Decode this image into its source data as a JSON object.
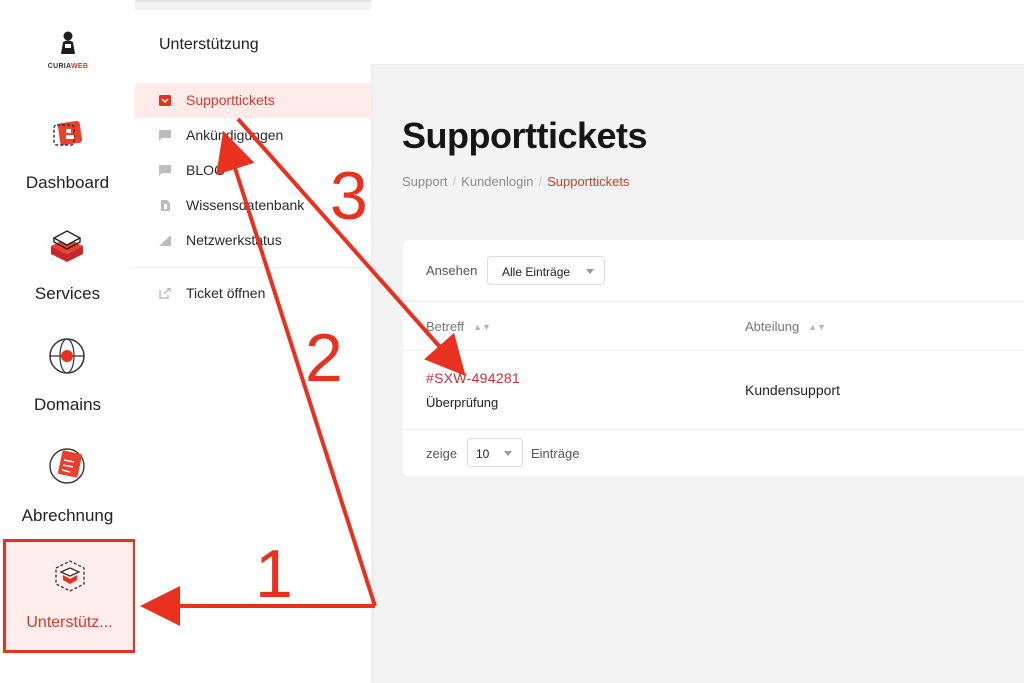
{
  "brand": {
    "logo_text_a": "CURIA",
    "logo_text_b": "WEB"
  },
  "rail": {
    "items": [
      {
        "label": "Dashboard",
        "icon": "dashboard-icon"
      },
      {
        "label": "Services",
        "icon": "services-icon"
      },
      {
        "label": "Domains",
        "icon": "globe-icon"
      },
      {
        "label": "Abrechnung",
        "icon": "billing-icon"
      },
      {
        "label": "Unterstütz...",
        "icon": "support-box-icon"
      }
    ]
  },
  "subnav": {
    "title": "Unterstützung",
    "items": [
      {
        "label": "Supporttickets",
        "icon": "ticket-icon"
      },
      {
        "label": "Ankündigungen",
        "icon": "comment-icon"
      },
      {
        "label": "BLOG",
        "icon": "comment-icon"
      },
      {
        "label": "Wissensdatenbank",
        "icon": "file-icon"
      },
      {
        "label": "Netzwerkstatus",
        "icon": "signal-icon"
      },
      {
        "label": "Ticket öffnen",
        "icon": "external-link-icon"
      }
    ]
  },
  "page": {
    "title": "Supporttickets",
    "breadcrumb": [
      "Support",
      "Kundenlogin",
      "Supporttickets"
    ]
  },
  "table": {
    "filter_label": "Ansehen",
    "filter_value": "Alle Einträge",
    "columns": [
      "Betreff",
      "Abteilung"
    ],
    "rows": [
      {
        "id": "#SXW-494281",
        "subject": "Überprüfung",
        "department": "Kundensupport"
      }
    ],
    "show_label": "zeige",
    "page_size": "10",
    "entries_label": "Einträge"
  },
  "annotations": {
    "step1": "1",
    "step2": "2",
    "step3": "3"
  },
  "colors": {
    "accent": "#d63a2c",
    "annotation": "#e8321f"
  }
}
